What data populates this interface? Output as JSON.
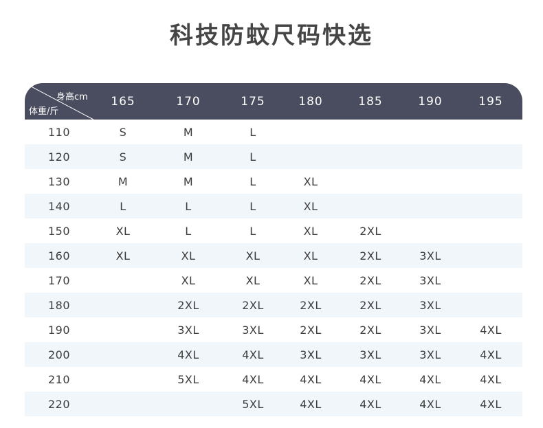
{
  "title": "科技防蚊尺码快选",
  "table": {
    "corner_height_label": "身高cm",
    "corner_weight_label": "体重/斤",
    "heights": [
      "165",
      "170",
      "175",
      "180",
      "185",
      "190",
      "195"
    ],
    "rows": [
      {
        "weight": "110",
        "sizes": [
          "S",
          "M",
          "L",
          "",
          "",
          "",
          ""
        ]
      },
      {
        "weight": "120",
        "sizes": [
          "S",
          "M",
          "L",
          "",
          "",
          "",
          ""
        ]
      },
      {
        "weight": "130",
        "sizes": [
          "M",
          "M",
          "L",
          "XL",
          "",
          "",
          ""
        ]
      },
      {
        "weight": "140",
        "sizes": [
          "L",
          "L",
          "L",
          "XL",
          "",
          "",
          ""
        ]
      },
      {
        "weight": "150",
        "sizes": [
          "XL",
          "L",
          "L",
          "XL",
          "2XL",
          "",
          ""
        ]
      },
      {
        "weight": "160",
        "sizes": [
          "XL",
          "XL",
          "XL",
          "XL",
          "2XL",
          "3XL",
          ""
        ]
      },
      {
        "weight": "170",
        "sizes": [
          "",
          "XL",
          "XL",
          "XL",
          "2XL",
          "3XL",
          ""
        ]
      },
      {
        "weight": "180",
        "sizes": [
          "",
          "2XL",
          "2XL",
          "2XL",
          "2XL",
          "3XL",
          ""
        ]
      },
      {
        "weight": "190",
        "sizes": [
          "",
          "3XL",
          "3XL",
          "2XL",
          "2XL",
          "3XL",
          "4XL"
        ]
      },
      {
        "weight": "200",
        "sizes": [
          "",
          "4XL",
          "4XL",
          "3XL",
          "3XL",
          "3XL",
          "4XL"
        ]
      },
      {
        "weight": "210",
        "sizes": [
          "",
          "5XL",
          "4XL",
          "4XL",
          "4XL",
          "4XL",
          "4XL"
        ]
      },
      {
        "weight": "220",
        "sizes": [
          "",
          "",
          "5XL",
          "4XL",
          "4XL",
          "4XL",
          "4XL"
        ]
      }
    ]
  },
  "colors": {
    "header_bg": "#4a4c5f",
    "stripe_bg": "#f1f6fb",
    "text": "#3c3c3c"
  }
}
